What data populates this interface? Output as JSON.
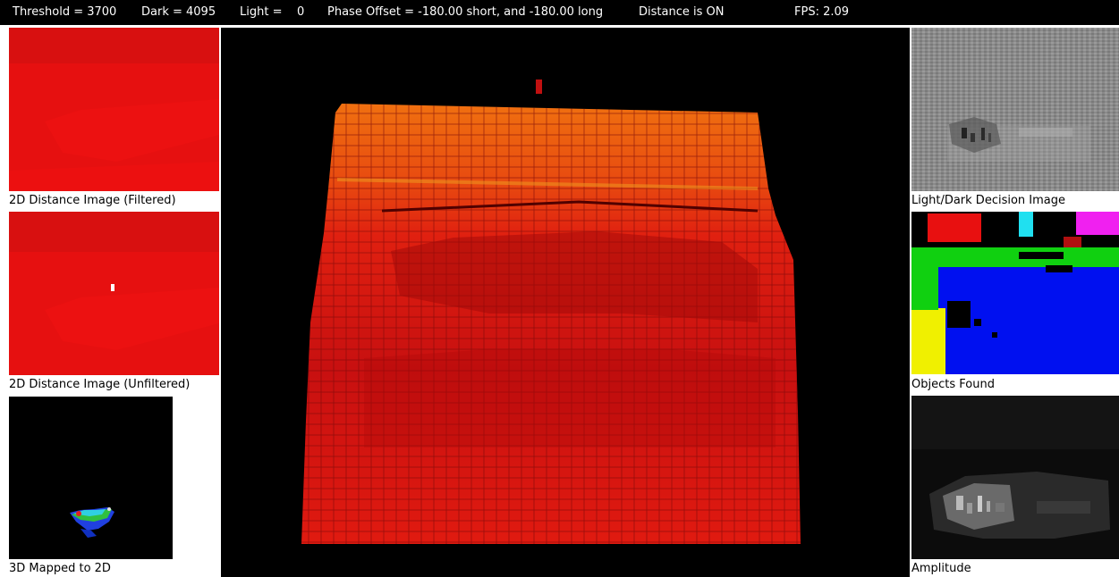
{
  "status": {
    "threshold": "Threshold = 3700",
    "dark": "Dark = 4095",
    "light": "Light =    0",
    "phase_offset": "Phase Offset = -180.00 short, and -180.00 long",
    "distance": "Distance is ON",
    "fps": "FPS: 2.09"
  },
  "panels": {
    "filtered_caption": "2D Distance Image (Filtered)",
    "unfiltered_caption": "2D Distance Image (Unfiltered)",
    "mapped_caption": "3D Mapped to 2D",
    "decision_caption": "Light/Dark Decision Image",
    "objects_caption": "Objects Found",
    "amplitude_caption": "Amplitude"
  },
  "colors": {
    "background": "#000000",
    "distance_red": "#e81010",
    "object_blue": "#0010f0",
    "object_green": "#10d010",
    "object_yellow": "#f0f000",
    "object_magenta": "#f020f0",
    "object_cyan": "#20e0f0"
  }
}
